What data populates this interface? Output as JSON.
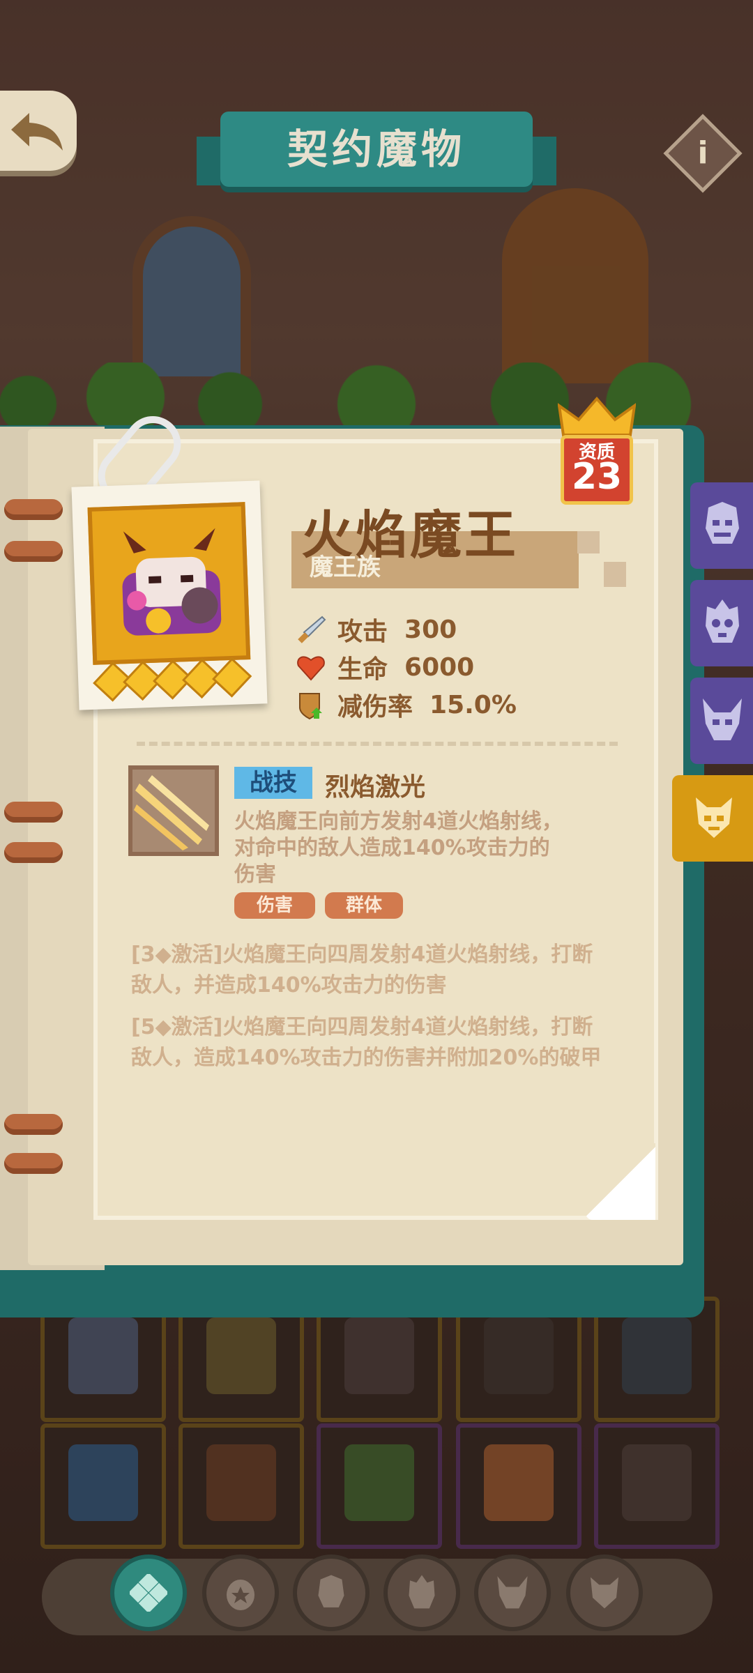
{
  "header": {
    "title": "契约魔物"
  },
  "monster": {
    "name": "火焰魔王",
    "tribe": "魔王族",
    "quality_label": "资质",
    "quality_value": "23",
    "star_count": 5,
    "stats": [
      {
        "icon": "sword-icon",
        "label": "攻击",
        "value": "300"
      },
      {
        "icon": "heart-icon",
        "label": "生命",
        "value": "6000"
      },
      {
        "icon": "shield-icon",
        "label": "减伤率",
        "value": "15.0%"
      }
    ]
  },
  "skill": {
    "tag": "战技",
    "name": "烈焰激光",
    "description_lines": [
      "火焰魔王向前方发射4道火焰射线，",
      "对命中的敌人造成140%攻击力的",
      "伤害"
    ],
    "chips": [
      "伤害",
      "群体"
    ]
  },
  "activations": [
    {
      "lines": [
        "[3◆激活]火焰魔王向四周发射4道火焰射线，打断",
        "敌人，并造成140%攻击力的伤害"
      ]
    },
    {
      "lines": [
        "[5◆激活]火焰魔王向四周发射4道火焰射线，打断",
        "敌人，造成140%攻击力的伤害并附加20%的破甲"
      ]
    }
  ],
  "side_tabs": [
    {
      "name": "demon-face-icon",
      "active": false
    },
    {
      "name": "skull-flame-icon",
      "active": false
    },
    {
      "name": "horned-mask-icon",
      "active": false
    },
    {
      "name": "devil-face-icon",
      "active": true
    }
  ],
  "bottom_nav": [
    {
      "name": "all-icon",
      "active": true
    },
    {
      "name": "egg-icon",
      "active": false
    },
    {
      "name": "demon-face-icon",
      "active": false
    },
    {
      "name": "skull-flame-icon",
      "active": false
    },
    {
      "name": "horned-mask-icon",
      "active": false
    },
    {
      "name": "devil-face-icon",
      "active": false
    }
  ],
  "colors": {
    "accent_teal": "#2e8a84",
    "accent_gold": "#d79a13",
    "tab_purple": "#5a4a9a",
    "skill_tag_blue": "#5fb8e6",
    "chip_orange": "#d27a4e",
    "quality_red": "#d2432f"
  }
}
